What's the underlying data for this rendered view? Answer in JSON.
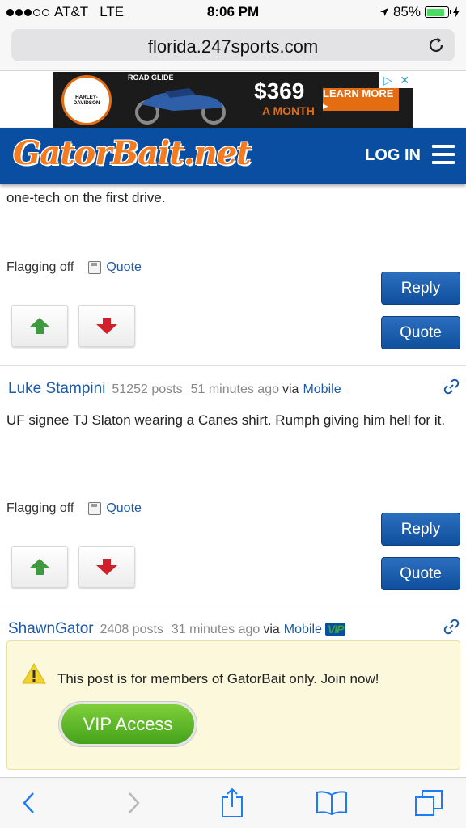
{
  "status": {
    "carrier": "AT&T",
    "network": "LTE",
    "time": "8:06 PM",
    "battery": "85%",
    "battery_level": 0.85,
    "signal_bars_filled": 3
  },
  "browser": {
    "url": "florida.247sports.com"
  },
  "ad": {
    "brand": "HARLEY-DAVIDSON",
    "model": "ROAD GLIDE",
    "price": "$369",
    "per": "A MONTH",
    "cta": "LEARN MORE ▸"
  },
  "site": {
    "logo": "GatorBait.net",
    "login": "LOG IN"
  },
  "posts": [
    {
      "body": "one-tech on the first drive.",
      "flagging": "Flagging off",
      "quote_link": "Quote",
      "reply_button": "Reply",
      "quote_button": "Quote"
    },
    {
      "author": "Luke Stampini",
      "posts": "51252 posts",
      "time": "51 minutes ago",
      "via": "via",
      "device": "Mobile",
      "body": "UF signee TJ Slaton wearing a Canes shirt. Rumph giving him hell for it.",
      "flagging": "Flagging off",
      "quote_link": "Quote",
      "reply_button": "Reply",
      "quote_button": "Quote"
    },
    {
      "author": "ShawnGator",
      "posts": "2408 posts",
      "time": "31 minutes ago",
      "via": "via",
      "device": "Mobile",
      "badge": "VIP",
      "members_notice": "This post is for members of GatorBait only. Join now!",
      "vip_button": "VIP Access"
    }
  ],
  "colors": {
    "header_blue": "#0a4ea2",
    "logo_orange": "#f47b20",
    "link_blue": "#1a5aa8",
    "vote_up": "#3f9a3f",
    "vote_down": "#d0202a",
    "vip_green": "#5bb829"
  }
}
